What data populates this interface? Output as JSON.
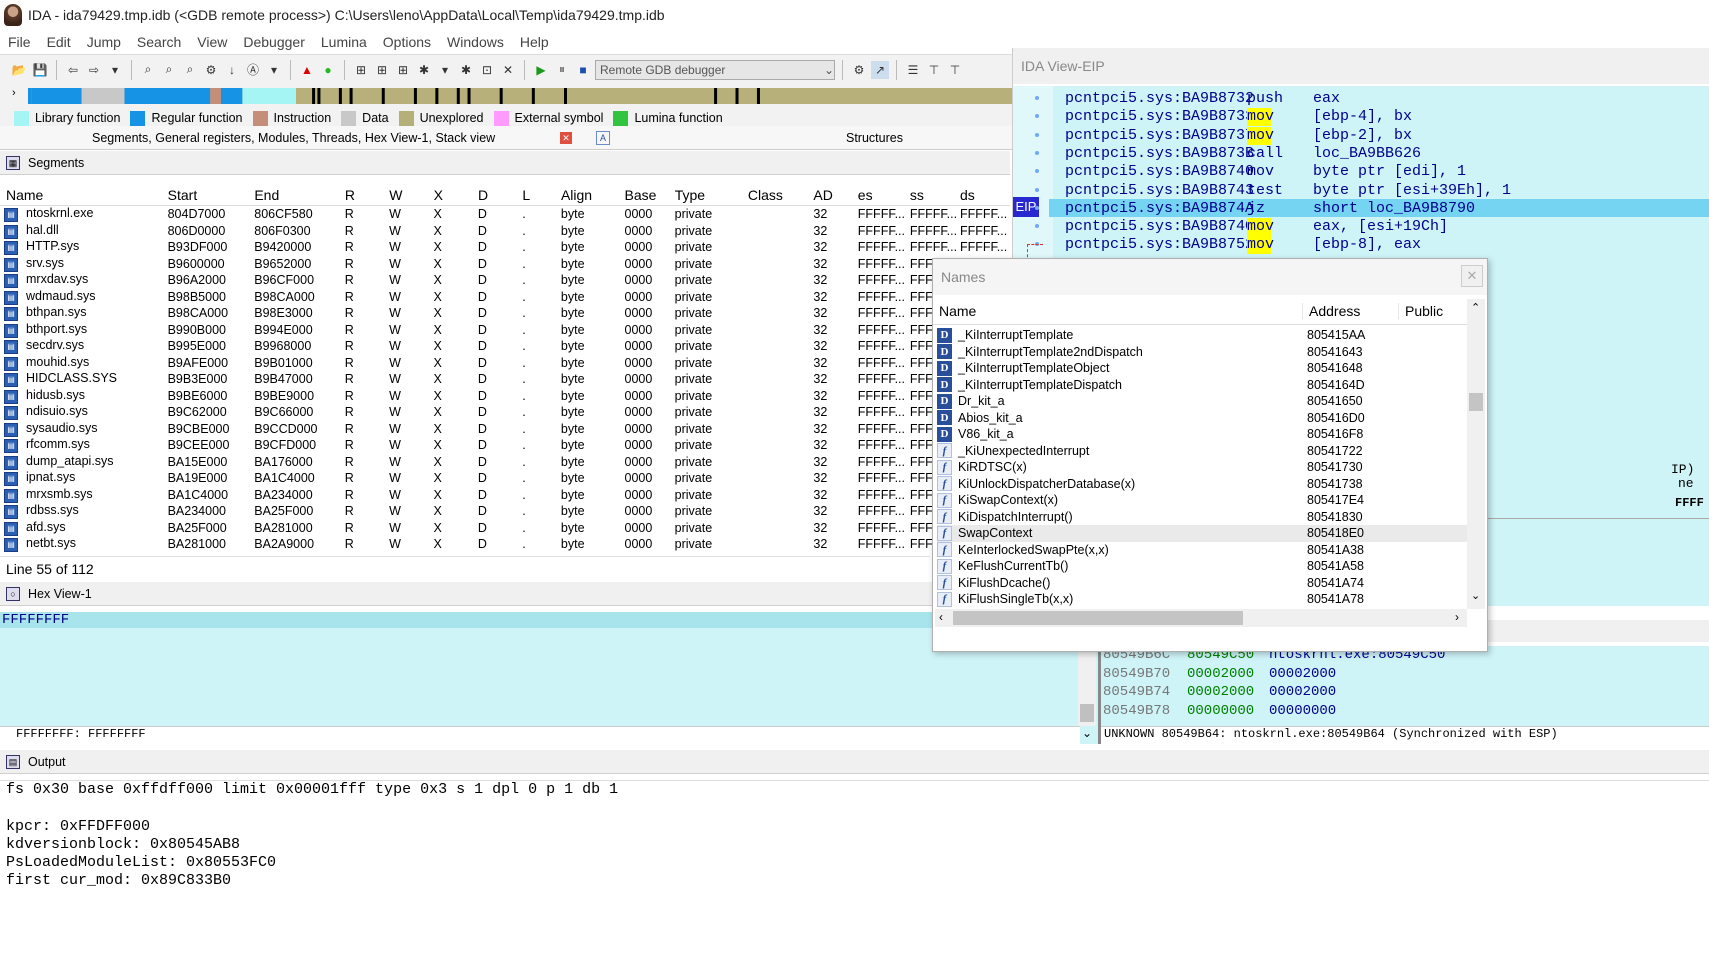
{
  "titlebar": {
    "title": "IDA - ida79429.tmp.idb (<GDB remote process>) C:\\Users\\leno\\AppData\\Local\\Temp\\ida79429.tmp.idb"
  },
  "menu": [
    "File",
    "Edit",
    "Jump",
    "Search",
    "View",
    "Debugger",
    "Lumina",
    "Options",
    "Windows",
    "Help"
  ],
  "toolbar": {
    "debugger_select": "Remote GDB debugger"
  },
  "legend": [
    {
      "label": "Library function",
      "color": "#a5f5f5"
    },
    {
      "label": "Regular function",
      "color": "#1793e6"
    },
    {
      "label": "Instruction",
      "color": "#c58e79"
    },
    {
      "label": "Data",
      "color": "#c8c8c8"
    },
    {
      "label": "Unexplored",
      "color": "#b5b07a"
    },
    {
      "label": "External symbol",
      "color": "#ff9aff"
    },
    {
      "label": "Lumina function",
      "color": "#33c43f"
    }
  ],
  "tabs": {
    "left": "Segments, General registers, Modules, Threads, Hex View-1, Stack view",
    "right": "Structures"
  },
  "segments": {
    "title": "Segments",
    "columns": [
      "Name",
      "Start",
      "End",
      "R",
      "W",
      "X",
      "D",
      "L",
      "Align",
      "Base",
      "Type",
      "Class",
      "AD",
      "es",
      "ss",
      "ds"
    ],
    "rows": [
      [
        "ntoskrnl.exe",
        "804D7000",
        "806CF580",
        "R",
        "W",
        "X",
        "D",
        ".",
        "byte",
        "0000",
        "private",
        "",
        "32",
        "FFFFF...",
        "FFFFF...",
        "FFFFF..."
      ],
      [
        "hal.dll",
        "806D0000",
        "806F0300",
        "R",
        "W",
        "X",
        "D",
        ".",
        "byte",
        "0000",
        "private",
        "",
        "32",
        "FFFFF...",
        "FFFFF...",
        "FFFFF..."
      ],
      [
        "HTTP.sys",
        "B93DF000",
        "B9420000",
        "R",
        "W",
        "X",
        "D",
        ".",
        "byte",
        "0000",
        "private",
        "",
        "32",
        "FFFFF...",
        "FFFFF...",
        "FFFFF..."
      ],
      [
        "srv.sys",
        "B9600000",
        "B9652000",
        "R",
        "W",
        "X",
        "D",
        ".",
        "byte",
        "0000",
        "private",
        "",
        "32",
        "FFFFF...",
        "FFFF",
        ""
      ],
      [
        "mrxdav.sys",
        "B96A2000",
        "B96CF000",
        "R",
        "W",
        "X",
        "D",
        ".",
        "byte",
        "0000",
        "private",
        "",
        "32",
        "FFFFF...",
        "FFFF",
        ""
      ],
      [
        "wdmaud.sys",
        "B98B5000",
        "B98CA000",
        "R",
        "W",
        "X",
        "D",
        ".",
        "byte",
        "0000",
        "private",
        "",
        "32",
        "FFFFF...",
        "FFFF",
        ""
      ],
      [
        "bthpan.sys",
        "B98CA000",
        "B98E3000",
        "R",
        "W",
        "X",
        "D",
        ".",
        "byte",
        "0000",
        "private",
        "",
        "32",
        "FFFFF...",
        "FFFF",
        ""
      ],
      [
        "bthport.sys",
        "B990B000",
        "B994E000",
        "R",
        "W",
        "X",
        "D",
        ".",
        "byte",
        "0000",
        "private",
        "",
        "32",
        "FFFFF...",
        "FFFF",
        ""
      ],
      [
        "secdrv.sys",
        "B995E000",
        "B9968000",
        "R",
        "W",
        "X",
        "D",
        ".",
        "byte",
        "0000",
        "private",
        "",
        "32",
        "FFFFF...",
        "FFFF",
        ""
      ],
      [
        "mouhid.sys",
        "B9AFE000",
        "B9B01000",
        "R",
        "W",
        "X",
        "D",
        ".",
        "byte",
        "0000",
        "private",
        "",
        "32",
        "FFFFF...",
        "FFFF",
        ""
      ],
      [
        "HIDCLASS.SYS",
        "B9B3E000",
        "B9B47000",
        "R",
        "W",
        "X",
        "D",
        ".",
        "byte",
        "0000",
        "private",
        "",
        "32",
        "FFFFF...",
        "FFFF",
        ""
      ],
      [
        "hidusb.sys",
        "B9BE6000",
        "B9BE9000",
        "R",
        "W",
        "X",
        "D",
        ".",
        "byte",
        "0000",
        "private",
        "",
        "32",
        "FFFFF...",
        "FFFF",
        ""
      ],
      [
        "ndisuio.sys",
        "B9C62000",
        "B9C66000",
        "R",
        "W",
        "X",
        "D",
        ".",
        "byte",
        "0000",
        "private",
        "",
        "32",
        "FFFFF...",
        "FFFF",
        ""
      ],
      [
        "sysaudio.sys",
        "B9CBE000",
        "B9CCD000",
        "R",
        "W",
        "X",
        "D",
        ".",
        "byte",
        "0000",
        "private",
        "",
        "32",
        "FFFFF...",
        "FFFF",
        ""
      ],
      [
        "rfcomm.sys",
        "B9CEE000",
        "B9CFD000",
        "R",
        "W",
        "X",
        "D",
        ".",
        "byte",
        "0000",
        "private",
        "",
        "32",
        "FFFFF...",
        "FFFF",
        ""
      ],
      [
        "dump_atapi.sys",
        "BA15E000",
        "BA176000",
        "R",
        "W",
        "X",
        "D",
        ".",
        "byte",
        "0000",
        "private",
        "",
        "32",
        "FFFFF...",
        "FFFF",
        ""
      ],
      [
        "ipnat.sys",
        "BA19E000",
        "BA1C4000",
        "R",
        "W",
        "X",
        "D",
        ".",
        "byte",
        "0000",
        "private",
        "",
        "32",
        "FFFFF...",
        "FFFF",
        ""
      ],
      [
        "mrxsmb.sys",
        "BA1C4000",
        "BA234000",
        "R",
        "W",
        "X",
        "D",
        ".",
        "byte",
        "0000",
        "private",
        "",
        "32",
        "FFFFF...",
        "FFFF",
        ""
      ],
      [
        "rdbss.sys",
        "BA234000",
        "BA25F000",
        "R",
        "W",
        "X",
        "D",
        ".",
        "byte",
        "0000",
        "private",
        "",
        "32",
        "FFFFF...",
        "FFFF",
        ""
      ],
      [
        "afd.sys",
        "BA25F000",
        "BA281000",
        "R",
        "W",
        "X",
        "D",
        ".",
        "byte",
        "0000",
        "private",
        "",
        "32",
        "FFFFF...",
        "FFFF",
        ""
      ],
      [
        "netbt.sys",
        "BA281000",
        "BA2A9000",
        "R",
        "W",
        "X",
        "D",
        ".",
        "byte",
        "0000",
        "private",
        "",
        "32",
        "FFFFF...",
        "FFFF",
        ""
      ]
    ],
    "status": "Line 55 of 112"
  },
  "ida_view": {
    "title": "IDA View-EIP",
    "eip_label": "EIP",
    "lines": [
      {
        "addr": "pcntpci5.sys:BA9B8732",
        "mn": "push",
        "op": "eax",
        "hl": false
      },
      {
        "addr": "pcntpci5.sys:BA9B8733",
        "mn": "mov",
        "op": "[ebp-4], bx",
        "hl": true
      },
      {
        "addr": "pcntpci5.sys:BA9B8737",
        "mn": "mov",
        "op": "[ebp-2], bx",
        "hl": true
      },
      {
        "addr": "pcntpci5.sys:BA9B873B",
        "mn": "call",
        "op": "loc_BA9BB626",
        "hl": false
      },
      {
        "addr": "pcntpci5.sys:BA9B8740",
        "mn": "mov",
        "op": "byte ptr [edi], 1",
        "hl": false
      },
      {
        "addr": "pcntpci5.sys:BA9B8743",
        "mn": "test",
        "op": "byte ptr [esi+39Eh], 1",
        "hl": false
      },
      {
        "addr": "pcntpci5.sys:BA9B874A",
        "mn": "jz",
        "op": "short loc_BA9B8790",
        "hl": false
      },
      {
        "addr": "pcntpci5.sys:BA9B874C",
        "mn": "mov",
        "op": "eax, [esi+19Ch]",
        "hl": true
      },
      {
        "addr": "pcntpci5.sys:BA9B8752",
        "mn": "mov",
        "op": "[ebp-8], eax",
        "hl": true
      }
    ],
    "partial_right_1": "IP)",
    "partial_right_2": "ne",
    "partial_right_3": "FFFF"
  },
  "names": {
    "title": "Names",
    "columns": [
      "Name",
      "Address",
      "Public"
    ],
    "rows": [
      {
        "icon": "D",
        "name": "_KiInterruptTemplate",
        "addr": "805415AA"
      },
      {
        "icon": "D",
        "name": "_KiInterruptTemplate2ndDispatch",
        "addr": "80541643"
      },
      {
        "icon": "D",
        "name": "_KiInterruptTemplateObject",
        "addr": "80541648"
      },
      {
        "icon": "D",
        "name": "_KiInterruptTemplateDispatch",
        "addr": "8054164D"
      },
      {
        "icon": "D",
        "name": "Dr_kit_a",
        "addr": "80541650"
      },
      {
        "icon": "D",
        "name": "Abios_kit_a",
        "addr": "805416D0"
      },
      {
        "icon": "D",
        "name": "V86_kit_a",
        "addr": "805416F8"
      },
      {
        "icon": "f",
        "name": "_KiUnexpectedInterrupt",
        "addr": "80541722"
      },
      {
        "icon": "f",
        "name": "KiRDTSC(x)",
        "addr": "80541730"
      },
      {
        "icon": "f",
        "name": "KiUnlockDispatcherDatabase(x)",
        "addr": "80541738"
      },
      {
        "icon": "f",
        "name": "KiSwapContext(x)",
        "addr": "805417E4"
      },
      {
        "icon": "f",
        "name": "KiDispatchInterrupt()",
        "addr": "80541830"
      },
      {
        "icon": "f",
        "name": "SwapContext",
        "addr": "805418E0"
      },
      {
        "icon": "f",
        "name": "KeInterlockedSwapPte(x,x)",
        "addr": "80541A38"
      },
      {
        "icon": "f",
        "name": "KeFlushCurrentTb()",
        "addr": "80541A58"
      },
      {
        "icon": "f",
        "name": "KiFlushDcache()",
        "addr": "80541A74"
      },
      {
        "icon": "f",
        "name": "KiFlushSingleTb(x,x)",
        "addr": "80541A78"
      }
    ]
  },
  "hexview": {
    "title": "Hex View-1",
    "first_line": "FFFFFFFF",
    "status": "FFFFFFFF: FFFFFFFF"
  },
  "stack": {
    "rows": [
      {
        "a": "80549B6C",
        "v": "80549C50",
        "c": "ntoskrnl.exe:80549C50"
      },
      {
        "a": "80549B70",
        "v": "00002000",
        "c": "00002000"
      },
      {
        "a": "80549B74",
        "v": "00002000",
        "c": "00002000"
      },
      {
        "a": "80549B78",
        "v": "00000000",
        "c": "00000000"
      }
    ],
    "status": "UNKNOWN 80549B64: ntoskrnl.exe:80549B64 (Synchronized with ESP)"
  },
  "output": {
    "title": "Output",
    "lines": [
      "fs 0x30 base 0xffdff000 limit 0x00001fff type 0x3 s 1 dpl 0 p 1 db 1",
      "",
      "kpcr: 0xFFDFF000",
      "kdversionblock: 0x80545AB8",
      "PsLoadedModuleList: 0x80553FC0",
      "first cur_mod: 0x89C833B0"
    ]
  }
}
